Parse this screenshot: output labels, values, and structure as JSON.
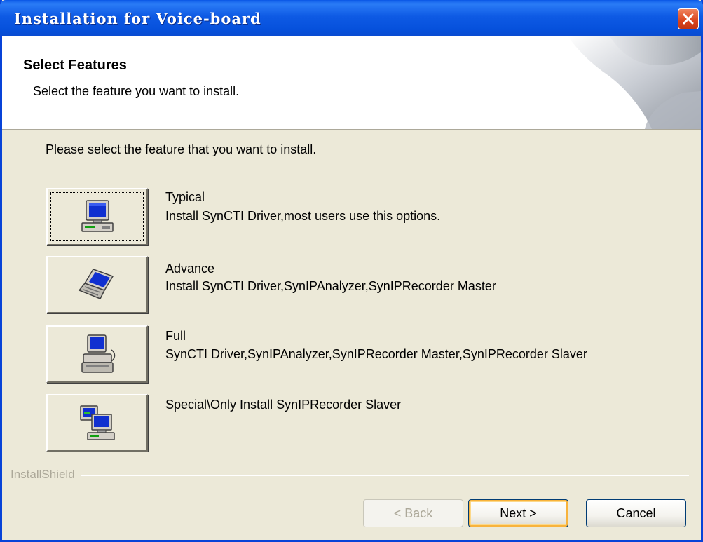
{
  "window": {
    "title": "Installation for Voice-board"
  },
  "header": {
    "title": "Select Features",
    "subtitle": "Select the feature you want to install."
  },
  "intro": "Please select the feature that you want to install.",
  "features": [
    {
      "title": "Typical",
      "description": "Install SynCTI Driver,most users use this options.",
      "icon": "desktop-computer-icon",
      "focused": true
    },
    {
      "title": "Advance",
      "description": "Install SynCTI Driver,SynIPAnalyzer,SynIPRecorder Master",
      "icon": "laptop-icon"
    },
    {
      "title": "Full",
      "description": "SynCTI Driver,SynIPAnalyzer,SynIPRecorder Master,SynIPRecorder Slaver",
      "icon": "computer-with-printer-icon"
    },
    {
      "title": "Special\\Only Install SynIPRecorder Slaver",
      "description": "",
      "icon": "networked-computers-icon"
    }
  ],
  "brand": "InstallShield",
  "buttons": {
    "back": "< Back",
    "next": "Next >",
    "cancel": "Cancel"
  },
  "colors": {
    "titlebar": "#0a57e6",
    "dialog_bg": "#ece9d8",
    "close": "#d9441c",
    "default_button_highlight": "#f8b33c"
  }
}
